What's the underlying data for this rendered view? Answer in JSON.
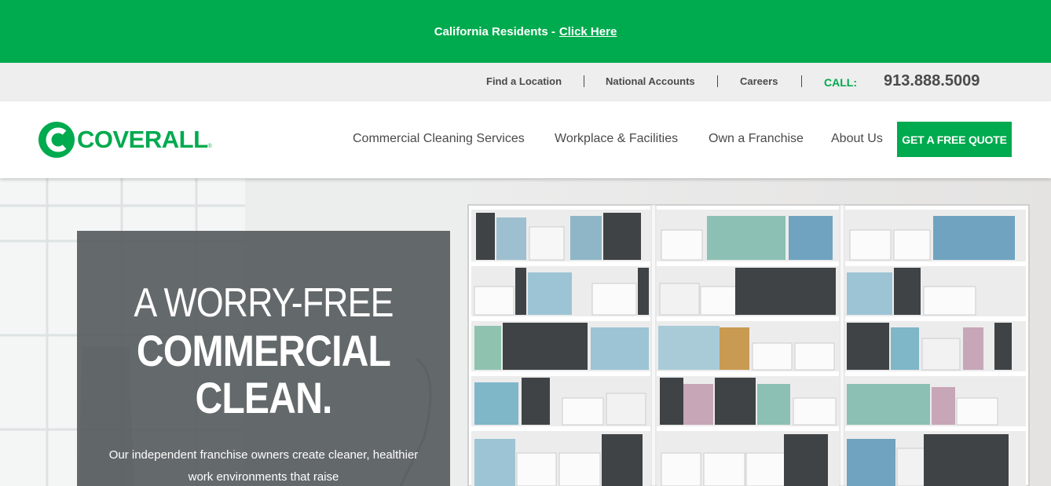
{
  "banner": {
    "text": "California Residents - ",
    "link_label": "Click Here"
  },
  "utility": {
    "links": [
      "Find a Location",
      "National Accounts",
      "Careers"
    ],
    "call_label": "CALL:",
    "phone": "913.888.5009"
  },
  "logo": {
    "text": "COVERALL",
    "reg": "®"
  },
  "nav": {
    "items": [
      "Commercial Cleaning Services",
      "Workplace & Facilities",
      "Own a Franchise",
      "About Us"
    ],
    "cta_label": "GET A FREE QUOTE"
  },
  "hero": {
    "line1": "A WORRY-FREE",
    "line2": "COMMERCIAL",
    "line3": "CLEAN.",
    "subtitle": "Our independent franchise owners create cleaner, healthier work environments that raise"
  },
  "colors": {
    "brand_green": "#00aa4e",
    "utility_bg": "#eeeeee",
    "text_gray": "#4a4a4a",
    "hero_panel": "#585e60"
  }
}
